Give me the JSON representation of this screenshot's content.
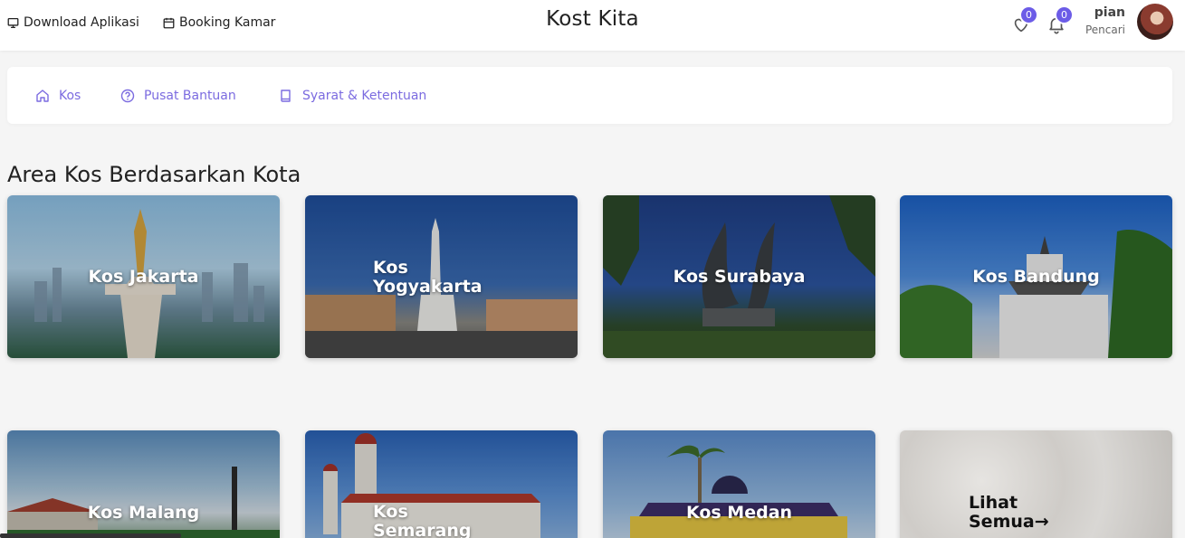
{
  "header": {
    "download_label": "Download Aplikasi",
    "booking_label": "Booking Kamar",
    "title": "Kost Kita",
    "wishlist_count": "0",
    "notification_count": "0",
    "user_name": "pian",
    "user_role": "Pencari"
  },
  "nav": {
    "items": [
      {
        "label": "Kos",
        "icon": "home-icon"
      },
      {
        "label": "Pusat Bantuan",
        "icon": "help-circle-icon"
      },
      {
        "label": "Syarat & Ketentuan",
        "icon": "book-icon"
      }
    ]
  },
  "section": {
    "title": "Area Kos Berdasarkan Kota"
  },
  "cities": [
    {
      "label": "Kos Jakarta"
    },
    {
      "label": "Kos Yogyakarta"
    },
    {
      "label": "Kos Surabaya"
    },
    {
      "label": "Kos Bandung"
    },
    {
      "label": "Kos Malang"
    },
    {
      "label": "Kos Semarang"
    },
    {
      "label": "Kos Medan"
    },
    {
      "label": "Lihat Semua→"
    }
  ],
  "colors": {
    "accent": "#6c5ce7",
    "nav_text": "#7b6be0"
  }
}
